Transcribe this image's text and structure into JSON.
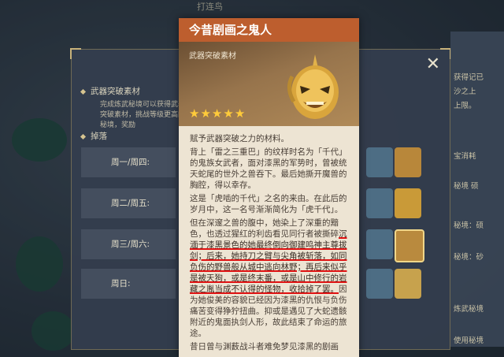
{
  "background": {
    "top_label": "打连鸟",
    "panel": {
      "section1": "武器突破素材",
      "desc": "完成炼武秘境可以获得武器突破素材，挑战等级更高的秘境，奖励",
      "section2": "掉落",
      "days": [
        "周一/周四:",
        "周二/周五:",
        "周三/周六:",
        "周日:"
      ],
      "close": "✕"
    },
    "right_panel": {
      "lines": [
        "获得记已",
        "沙之上",
        "上限。",
        "宝消耗",
        "秘境 硕",
        "秘境：硕",
        "秘境：砂",
        "炼武秘境",
        "使用秘境"
      ]
    }
  },
  "card": {
    "title": "今昔剧画之鬼人",
    "type": "武器突破素材",
    "stars": [
      "★",
      "★",
      "★",
      "★",
      "★"
    ],
    "paragraphs": [
      "赋予武器突破之力的材料。",
      "背上「雷之三重巴」的纹样时名为「千代」的鬼族女武者，面对漆黑的军势时，曾被统天蛇尾的世外之兽吞下。最后她撕开魔兽的胸腔，得以幸存。",
      "这是「虎啮的千代」之名的来由。在此后的岁月中，这一名号渐渐简化为「虎千代」。",
      "但在深邃之兽的腹中，她染上了深重的黯色，也透过猩红的利齿看见同行者被撕碎"
    ],
    "highlighted": [
      "沉湎于漆黑景色的她最终倒向御建鸣神主尊拔剑；后来，她持刀之臂与尖角被斩落，如同负伤的野兽般从城中逃向林野；再后来似乎是被天狗，或是终末番，或是山中修行的岩藏之胤当成不认得的怪物，收拾掉了罢。"
    ],
    "after_highlight": "因为她俊美的容貌已经因为漆黑的仇恨与负伤痛苦变得狰狞扭曲。抑或是遇见了大蛇遗骸附近的鬼面执剑人形，故此结束了命运的旅途。",
    "last_line": "昔日曾与渊薮战斗者难免梦见漆黑的剧画"
  },
  "colors": {
    "title_bar": "#bd5e2e",
    "card_bg": "#ede4d3",
    "highlight": "#e01010"
  }
}
